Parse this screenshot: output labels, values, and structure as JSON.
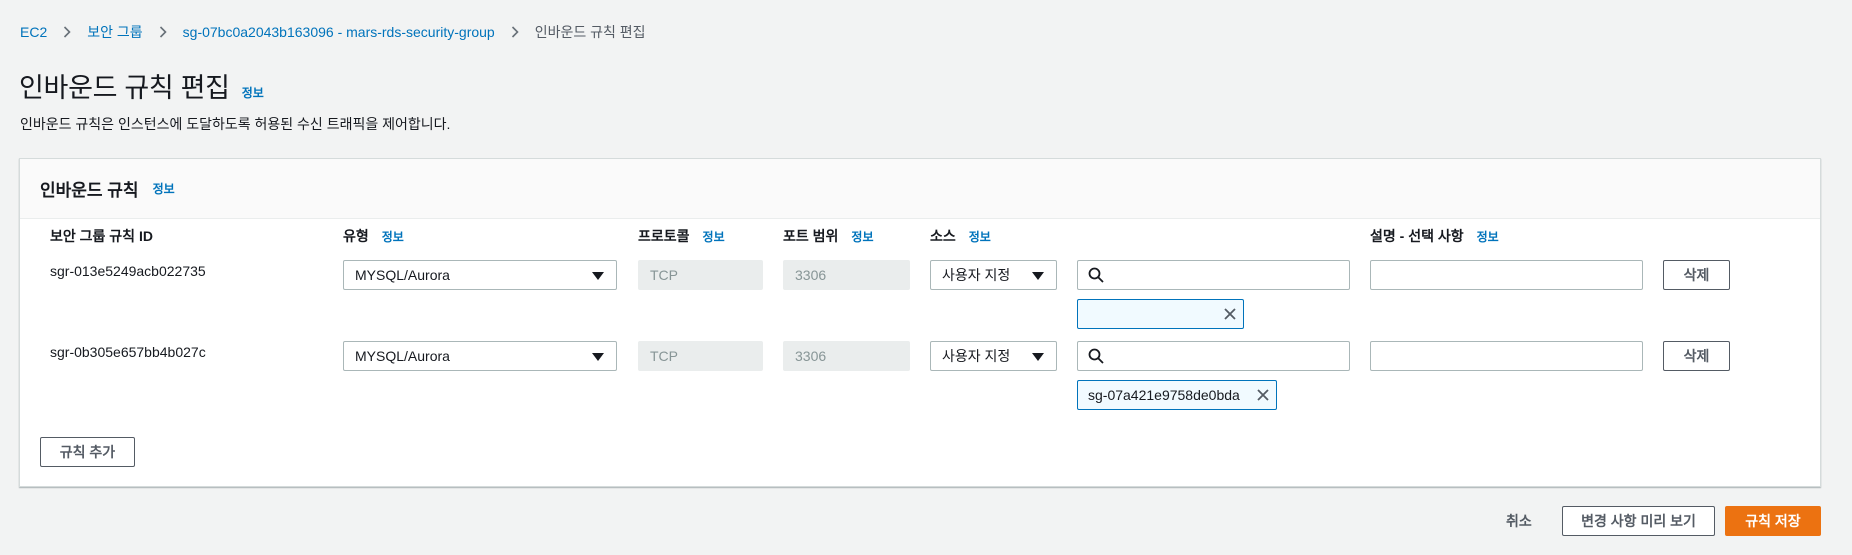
{
  "breadcrumb": {
    "items": [
      "EC2",
      "보안 그룹",
      "sg-07bc0a2043b163096 - mars-rds-security-group"
    ],
    "current": "인바운드 규칙 편집"
  },
  "header": {
    "title": "인바운드 규칙 편집",
    "info": "정보",
    "description": "인바운드 규칙은 인스턴스에 도달하도록 허용된 수신 트래픽을 제어합니다."
  },
  "panel": {
    "title": "인바운드 규칙",
    "info": "정보",
    "columns": {
      "rule_id": "보안 그룹 규칙 ID",
      "type": "유형",
      "protocol": "프로토콜",
      "port_range": "포트 범위",
      "source": "소스",
      "description": "설명 - 선택 사항",
      "info": "정보"
    },
    "rules": [
      {
        "id": "sgr-013e5249acb022735",
        "type": "MYSQL/Aurora",
        "protocol": "TCP",
        "port": "3306",
        "source_type": "사용자 지정",
        "source_search": "",
        "source_token": "",
        "description": "",
        "delete_label": "삭제"
      },
      {
        "id": "sgr-0b305e657bb4b027c",
        "type": "MYSQL/Aurora",
        "protocol": "TCP",
        "port": "3306",
        "source_type": "사용자 지정",
        "source_search": "",
        "source_token": "sg-07a421e9758de0bda",
        "description": "",
        "delete_label": "삭제"
      }
    ],
    "add_rule_label": "규칙 추가"
  },
  "footer": {
    "cancel_label": "취소",
    "preview_label": "변경 사항 미리 보기",
    "save_label": "규칙 저장"
  },
  "colors": {
    "link": "#0073bb",
    "primary": "#ec7211",
    "background": "#f2f3f3",
    "token_border": "#0073bb"
  },
  "icons": [
    "chevron-right-icon",
    "caret-down-icon",
    "search-icon",
    "close-icon"
  ]
}
